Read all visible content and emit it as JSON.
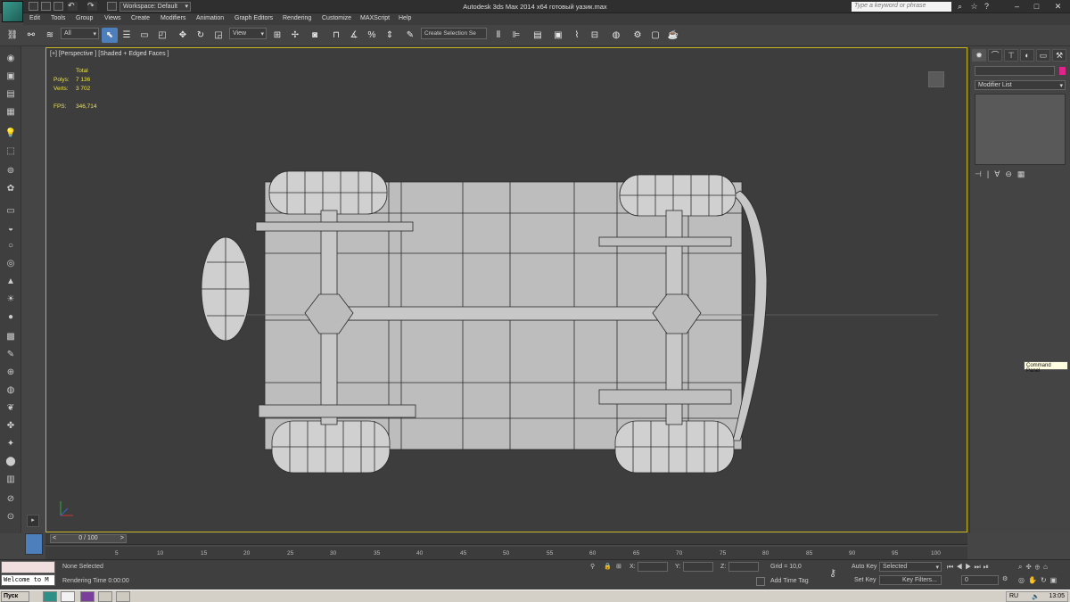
{
  "titlebar": {
    "workspace": "Workspace: Default",
    "window_title": "Autodesk 3ds Max 2014 x64    готовый уазик.max",
    "search_placeholder": "Type a keyword or phrase"
  },
  "menu": [
    "Edit",
    "Tools",
    "Group",
    "Views",
    "Create",
    "Modifiers",
    "Animation",
    "Graph Editors",
    "Rendering",
    "Customize",
    "MAXScript",
    "Help"
  ],
  "toolbar": {
    "filter": "All",
    "coord_system": "View",
    "selection_set": "Create Selection Se"
  },
  "viewport": {
    "label": "[+] [Perspective ] [Shaded + Edged Faces ]",
    "stats": {
      "total_label": "Total",
      "polys_label": "Polys:",
      "polys_value": "7 136",
      "verts_label": "Verts:",
      "verts_value": "3 702",
      "fps_label": "FPS:",
      "fps_value": "346,714"
    }
  },
  "command_panel": {
    "modifier_list": "Modifier List",
    "tooltip": "Command Panel",
    "accent_color": "#e0258a"
  },
  "timeline": {
    "frame_display": "0 / 100",
    "ticks": [
      "5",
      "10",
      "15",
      "20",
      "25",
      "30",
      "35",
      "40",
      "45",
      "50",
      "55",
      "60",
      "65",
      "70",
      "75",
      "80",
      "85",
      "90",
      "95",
      "100"
    ]
  },
  "status": {
    "maxscript_text": "Welcome to M",
    "selection": "None Selected",
    "rendering_time": "Rendering Time  0:00:00",
    "x_label": "X:",
    "y_label": "Y:",
    "z_label": "Z:",
    "grid": "Grid = 10,0",
    "add_time_tag": "Add Time Tag",
    "auto_key": "Auto Key",
    "set_key": "Set Key",
    "selected": "Selected",
    "key_filters": "Key Filters...",
    "frame_value": "0"
  },
  "taskbar": {
    "start": "Пуск",
    "language": "RU",
    "clock": "13:05"
  }
}
